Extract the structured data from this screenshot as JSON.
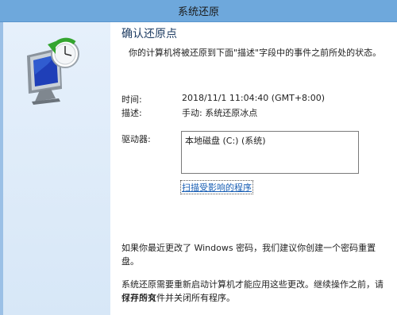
{
  "window": {
    "title": "系统还原"
  },
  "main": {
    "heading": "确认还原点",
    "subtitle": "你的计算机将被还原到下面\"描述\"字段中的事件之前所处的状态。",
    "time_label": "时间:",
    "time_value": "2018/11/1 11:04:40 (GMT+8:00)",
    "description_label": "描述:",
    "description_value": "手动: 系统还原冰点",
    "drives_label": "驱动器:",
    "drives": [
      "本地磁盘 (C:) (系统)"
    ],
    "scan_link": "扫描受影响的程序",
    "password_note": "如果你最近更改了 Windows 密码，我们建议你创建一个密码重置盘。",
    "restart_note_line1": "系统还原需要重新启动计算机才能应用这些更改。继续操作之前，请保存所有",
    "restart_note_line2": "打开的文件并关闭所有程序。"
  },
  "colors": {
    "titlebar": "#6ea8dc",
    "sidebar": "#e0ecf9",
    "link": "#1a5fb4"
  },
  "icons": {
    "sidebar_icon": "system-restore-icon"
  }
}
